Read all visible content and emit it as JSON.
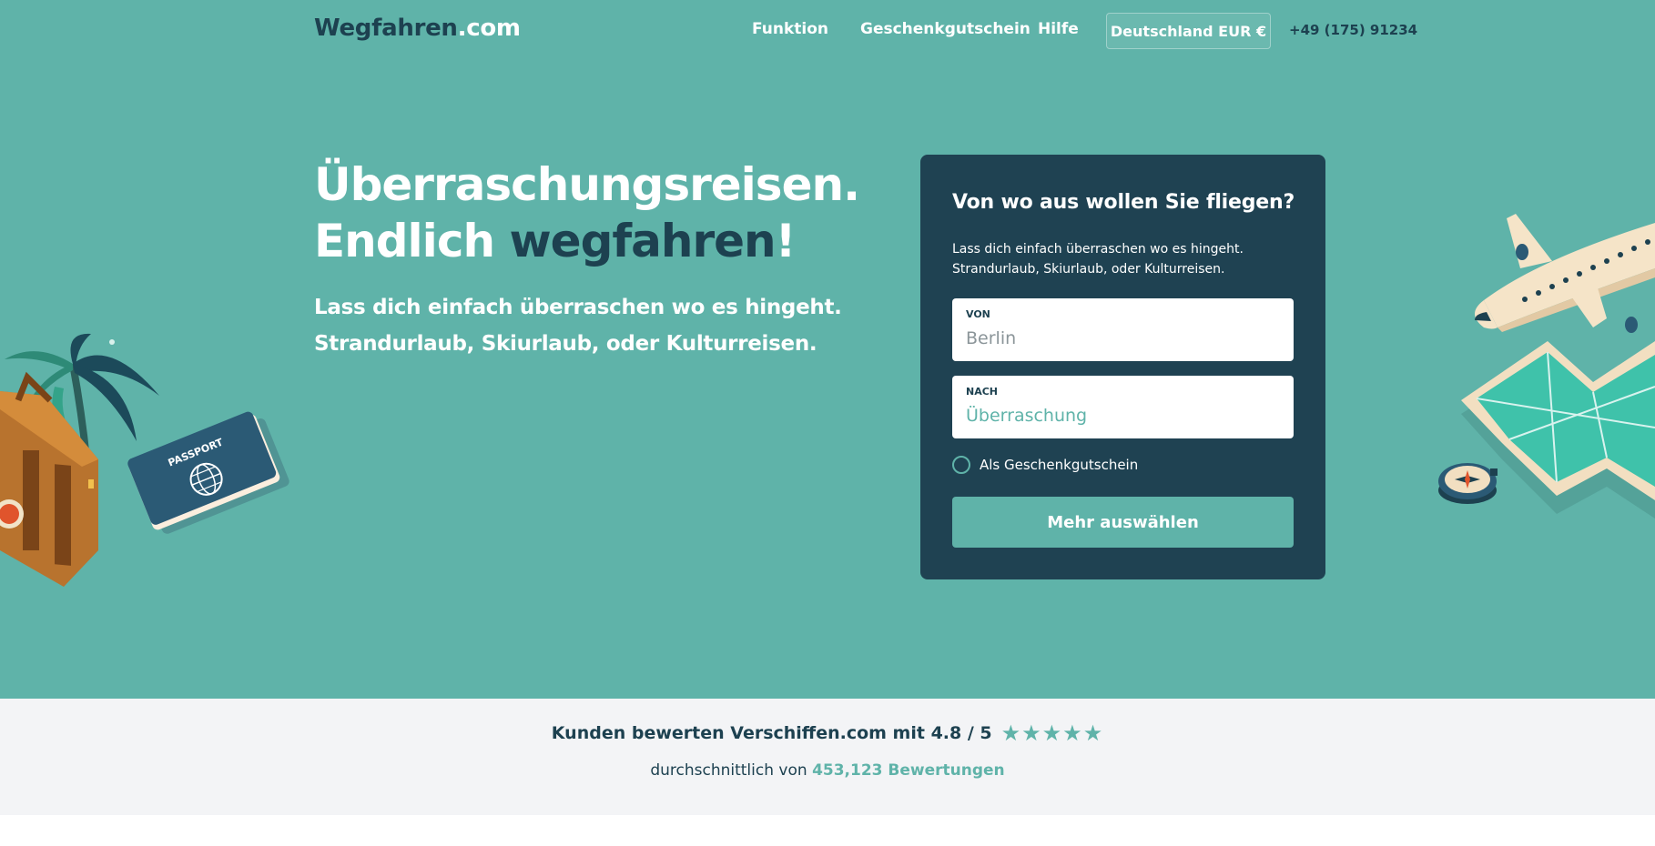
{
  "header": {
    "logo_main": "Wegfahren",
    "logo_tld": ".com",
    "nav": [
      "Funktion",
      "Geschenkgutschein",
      "Hilfe"
    ],
    "country_selector": "Deutschland EUR €",
    "phone": "+49 (175) 91234"
  },
  "hero": {
    "headline_line1": "Überraschungsreisen.",
    "headline_line2_prefix": "Endlich ",
    "headline_line2_accent": "wegfahren",
    "headline_line2_suffix": "!",
    "subline_line1": "Lass dich einfach überraschen wo es hingeht.",
    "subline_line2": "Strandurlaub, Skiurlaub, oder Kulturreisen."
  },
  "booking": {
    "title": "Von wo aus wollen Sie fliegen?",
    "desc_line1": "Lass dich einfach überraschen wo es hingeht.",
    "desc_line2": "Strandurlaub, Skiurlaub, oder Kulturreisen.",
    "from_label": "VON",
    "from_value": "Berlin",
    "to_label": "NACH",
    "to_value": "Überraschung",
    "gift_label": "Als Geschenkgutschein",
    "gift_checked": false,
    "submit_label": "Mehr auswählen"
  },
  "rating": {
    "text": "Kunden bewerten Verschiffen.com mit 4.8 / 5",
    "stars": 5,
    "stars_glyphs": "★★★★★",
    "avg_prefix": "durchschnittlich von",
    "count": "453,123 Bewertungen"
  },
  "colors": {
    "hero_bg": "#5fb3a9",
    "navy": "#1d4150",
    "card_bg": "#1f4252",
    "rating_bg": "#f3f4f6",
    "accent": "#5fb3a9"
  },
  "icons": [
    "suitcase-illustration",
    "palm-tree-illustration",
    "passport-illustration",
    "airplane-illustration",
    "map-illustration",
    "compass-illustration",
    "star-icon"
  ]
}
